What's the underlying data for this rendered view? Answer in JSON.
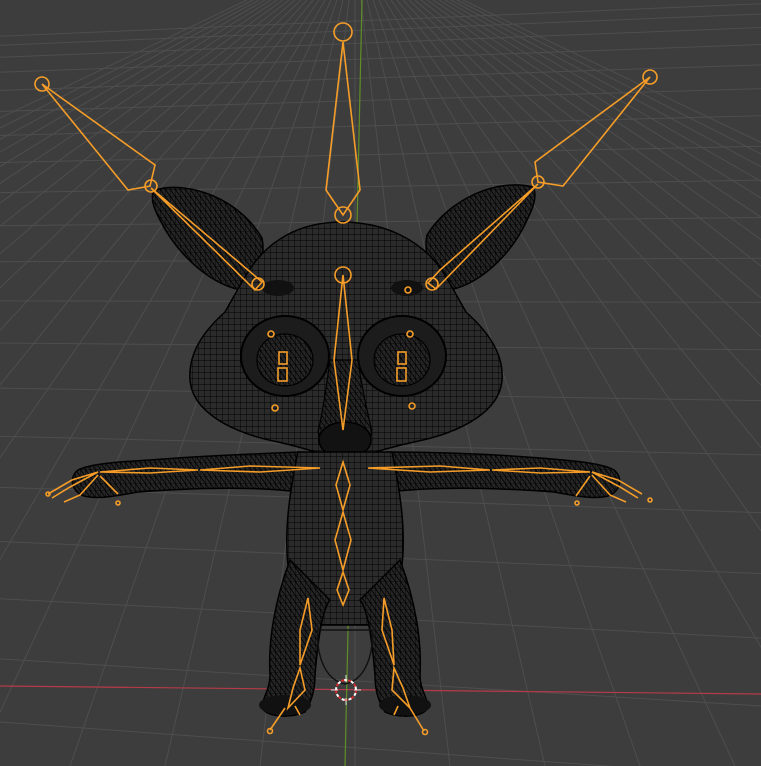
{
  "viewport": {
    "background": "#3d3d3d",
    "grid_color": "#4e4e4e",
    "x_axis_color": "#b53b48",
    "y_axis_color": "#5e8f26",
    "wire_color": "#000000",
    "bone_color": "#f59d28",
    "cursor_colors": [
      "#d62a2a",
      "#ffffff"
    ]
  },
  "scene": {
    "mesh": "fox-character-wireframe",
    "armature": "fox-character-rig",
    "pose": "t-pose",
    "cursor": "3d-cursor-icon"
  }
}
